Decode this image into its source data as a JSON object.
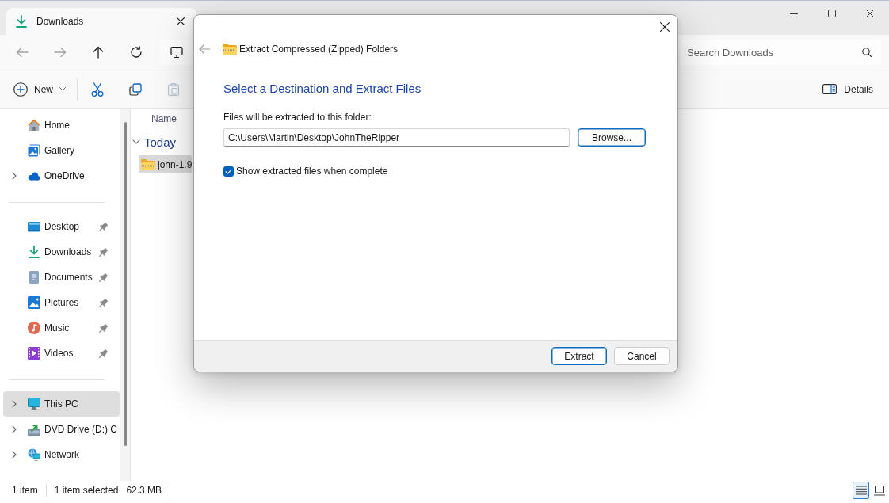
{
  "window": {
    "tab_title": "Downloads"
  },
  "navigation": [
    {
      "disabled": true
    },
    {
      "disabled": true
    },
    {
      "disabled": false
    },
    {
      "disabled": false
    }
  ],
  "search": {
    "placeholder": "Search Downloads"
  },
  "toolbar": {
    "new_label": "New",
    "actions": [
      {
        "disabled": false
      },
      {
        "disabled": false
      },
      {
        "disabled": true
      }
    ],
    "details_label": "Details"
  },
  "sidebar": {
    "sections": [
      {
        "items": [
          {
            "label": "Home",
            "expandable": false,
            "pinned": false,
            "selected": false
          },
          {
            "label": "Gallery",
            "expandable": false,
            "pinned": false,
            "selected": false
          },
          {
            "label": "OneDrive",
            "expandable": true,
            "pinned": false,
            "selected": false
          }
        ]
      },
      {
        "items": [
          {
            "label": "Desktop",
            "expandable": false,
            "pinned": true,
            "selected": false
          },
          {
            "label": "Downloads",
            "expandable": false,
            "pinned": true,
            "selected": false
          },
          {
            "label": "Documents",
            "expandable": false,
            "pinned": true,
            "selected": false
          },
          {
            "label": "Pictures",
            "expandable": false,
            "pinned": true,
            "selected": false
          },
          {
            "label": "Music",
            "expandable": false,
            "pinned": true,
            "selected": false
          },
          {
            "label": "Videos",
            "expandable": false,
            "pinned": true,
            "selected": false
          }
        ]
      },
      {
        "items": [
          {
            "label": "This PC",
            "expandable": true,
            "pinned": false,
            "selected": true
          },
          {
            "label": "DVD Drive (D:) C",
            "expandable": true,
            "pinned": false,
            "selected": false
          },
          {
            "label": "Network",
            "expandable": true,
            "pinned": false,
            "selected": false
          }
        ]
      }
    ]
  },
  "file_list": {
    "columns": [
      {
        "label": "Name"
      }
    ],
    "groups": [
      {
        "label": "Today",
        "expanded": true,
        "files": [
          {
            "name": "john-1.9",
            "selected": true
          }
        ]
      }
    ]
  },
  "status_bar": {
    "item_count": "1 item",
    "selection": "1 item selected",
    "selection_size": "62.3 MB",
    "views": [
      {
        "selected": true
      },
      {
        "selected": false
      }
    ]
  },
  "dialog": {
    "back_button": {
      "disabled": true
    },
    "title": "Extract Compressed (Zipped) Folders",
    "heading": "Select a Destination and Extract Files",
    "folder_label": "Files will be extracted to this folder:",
    "path_value": "C:\\Users\\Martin\\Desktop\\JohnTheRipper",
    "browse_button": {
      "label": "Browse...",
      "highlighted": true
    },
    "show_files": {
      "label": "Show extracted files when complete",
      "checked": true
    },
    "buttons": [
      {
        "label": "Extract",
        "highlighted": true
      },
      {
        "label": "Cancel",
        "highlighted": false
      }
    ]
  }
}
